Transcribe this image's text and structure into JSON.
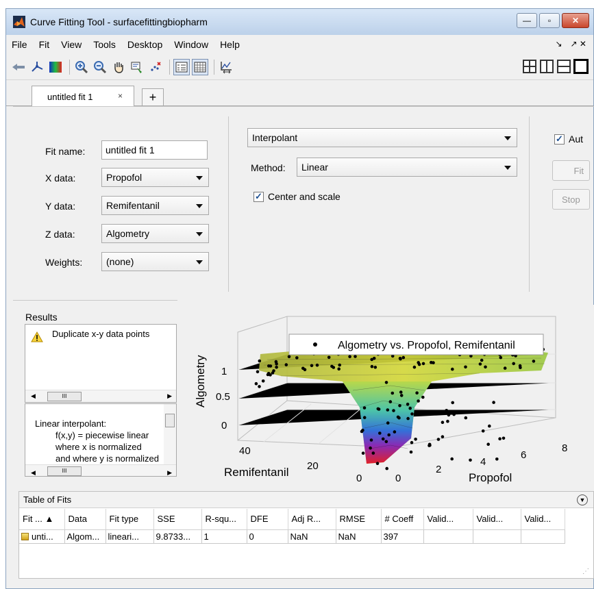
{
  "window": {
    "title": "Curve Fitting Tool - surfacefittingbiopharm",
    "controls": [
      "—",
      "▫",
      "✕"
    ]
  },
  "menu": {
    "items": [
      "File",
      "Fit",
      "View",
      "Tools",
      "Desktop",
      "Window",
      "Help"
    ],
    "right": [
      "↘",
      "↗ ✕"
    ]
  },
  "tabs": {
    "active_label": "untitled fit 1",
    "close": "×",
    "add": "+"
  },
  "fit_settings": {
    "fit_name_label": "Fit name:",
    "fit_name_value": "untitled fit 1",
    "x_label": "X data:",
    "x_value": "Propofol",
    "y_label": "Y data:",
    "y_value": "Remifentanil",
    "z_label": "Z data:",
    "z_value": "Algometry",
    "weights_label": "Weights:",
    "weights_value": "(none)",
    "fit_type": "Interpolant",
    "method_label": "Method:",
    "method_value": "Linear",
    "center_scale_label": "Center and scale",
    "center_scale_checked": true,
    "auto_label": "Aut",
    "auto_checked": true,
    "fit_button": "Fit",
    "stop_button": "Stop"
  },
  "results": {
    "title": "Results",
    "warning": "Duplicate x-y data points",
    "info_lines": [
      "Linear interpolant:",
      "f(x,y) = piecewise linear",
      "where x is normalized",
      "and where y is normalized"
    ],
    "scroll_thumb": "III"
  },
  "plot": {
    "legend": "Algometry vs. Propofol, Remifentanil",
    "z_label": "Algometry",
    "y_label": "Remifentanil",
    "x_label": "Propofol",
    "z_ticks": [
      "1",
      "0.5",
      "0"
    ],
    "y_ticks": [
      "40",
      "20",
      "0"
    ],
    "x_ticks": [
      "0",
      "2",
      "4",
      "6",
      "8"
    ]
  },
  "table_of_fits": {
    "title": "Table of Fits",
    "columns": [
      "Fit ... ▲",
      "Data",
      "Fit type",
      "SSE",
      "R-squ...",
      "DFE",
      "Adj R...",
      "RMSE",
      "# Coeff",
      "Valid...",
      "Valid...",
      "Valid..."
    ],
    "rows": [
      [
        "unti...",
        "Algom...",
        "lineari...",
        "9.8733...",
        "1",
        "0",
        "NaN",
        "NaN",
        "397",
        "",
        "",
        ""
      ]
    ]
  }
}
